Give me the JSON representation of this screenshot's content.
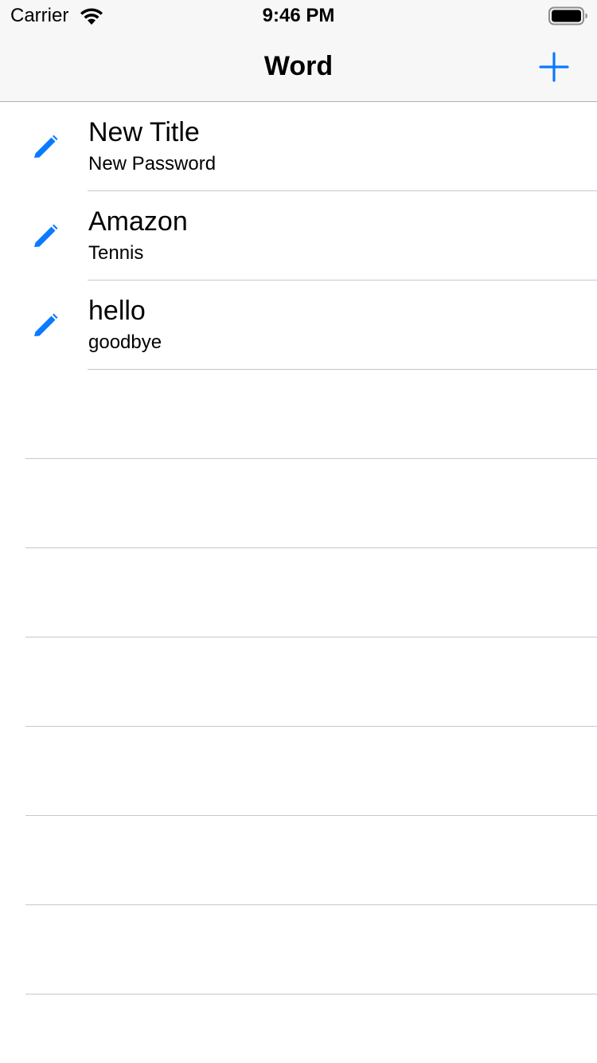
{
  "status_bar": {
    "carrier": "Carrier",
    "time": "9:46 PM",
    "wifi_icon": "wifi-icon",
    "battery_icon": "battery-full-icon"
  },
  "nav_bar": {
    "title": "Word",
    "add_icon": "plus-icon"
  },
  "accent_color": "#0a7aff",
  "rows": [
    {
      "title": "New Title",
      "subtitle": "New Password",
      "icon": "pencil-icon"
    },
    {
      "title": "Amazon",
      "subtitle": "Tennis",
      "icon": "pencil-icon"
    },
    {
      "title": "hello",
      "subtitle": "goodbye",
      "icon": "pencil-icon"
    }
  ]
}
